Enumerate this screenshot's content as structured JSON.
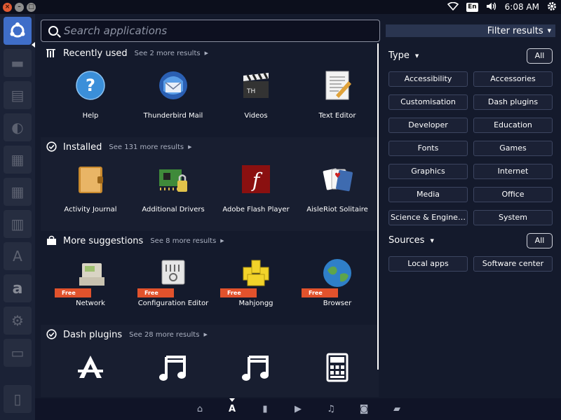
{
  "top_panel": {
    "keyboard": "En",
    "clock": "6:08 AM",
    "window_buttons": [
      "×",
      "–",
      "□"
    ]
  },
  "search": {
    "placeholder": "Search applications",
    "value": ""
  },
  "categories": [
    {
      "title": "Recently used",
      "more": "See 2 more results",
      "icon": "recent-icon",
      "items": [
        {
          "label": "Help",
          "icon": "help-icon"
        },
        {
          "label": "Thunderbird Mail",
          "icon": "thunderbird-icon"
        },
        {
          "label": "Videos",
          "icon": "videos-icon"
        },
        {
          "label": "Text Editor",
          "icon": "text-editor-icon"
        }
      ]
    },
    {
      "title": "Installed",
      "more": "See 131 more results",
      "icon": "installed-check-icon",
      "items": [
        {
          "label": "Activity Journal",
          "icon": "activity-journal-icon"
        },
        {
          "label": "Additional Drivers",
          "icon": "additional-drivers-icon"
        },
        {
          "label": "Adobe Flash Player",
          "icon": "flash-player-icon"
        },
        {
          "label": "AisleRiot Solitaire",
          "icon": "solitaire-icon"
        }
      ]
    },
    {
      "title": "More suggestions",
      "more": "See 8 more results",
      "icon": "shopping-bag-icon",
      "items": [
        {
          "label": "Network",
          "icon": "network-icon",
          "badge": "Free"
        },
        {
          "label": "Configuration Editor",
          "icon": "configuration-editor-icon",
          "badge": "Free"
        },
        {
          "label": "Mahjongg",
          "icon": "mahjongg-icon",
          "badge": "Free"
        },
        {
          "label": "Browser",
          "icon": "browser-globe-icon",
          "badge": "Free"
        }
      ]
    },
    {
      "title": "Dash plugins",
      "more": "See 28 more results",
      "icon": "plugins-check-icon",
      "items": [
        {
          "label": "",
          "icon": "applications-lens-icon"
        },
        {
          "label": "",
          "icon": "music-note-icon"
        },
        {
          "label": "",
          "icon": "music-note-icon"
        },
        {
          "label": "",
          "icon": "calculator-icon"
        }
      ]
    }
  ],
  "filters": {
    "header": "Filter results",
    "type_title": "Type",
    "all_label": "All",
    "types": [
      "Accessibility",
      "Accessories",
      "Customisation",
      "Dash plugins",
      "Developer",
      "Education",
      "Fonts",
      "Games",
      "Graphics",
      "Internet",
      "Media",
      "Office",
      "Science & Engine…",
      "System"
    ],
    "sources_title": "Sources",
    "sources": [
      "Local apps",
      "Software center"
    ]
  },
  "lens_bar": [
    "home-lens-icon",
    "applications-lens-icon",
    "files-lens-icon",
    "video-lens-icon",
    "music-lens-icon",
    "photos-lens-icon",
    "social-lens-icon"
  ],
  "colors": {
    "background": "#141a2c",
    "launcher_home": "#3f6ec9",
    "free_badge": "#e1522c",
    "filter_header": "#2a3550"
  }
}
